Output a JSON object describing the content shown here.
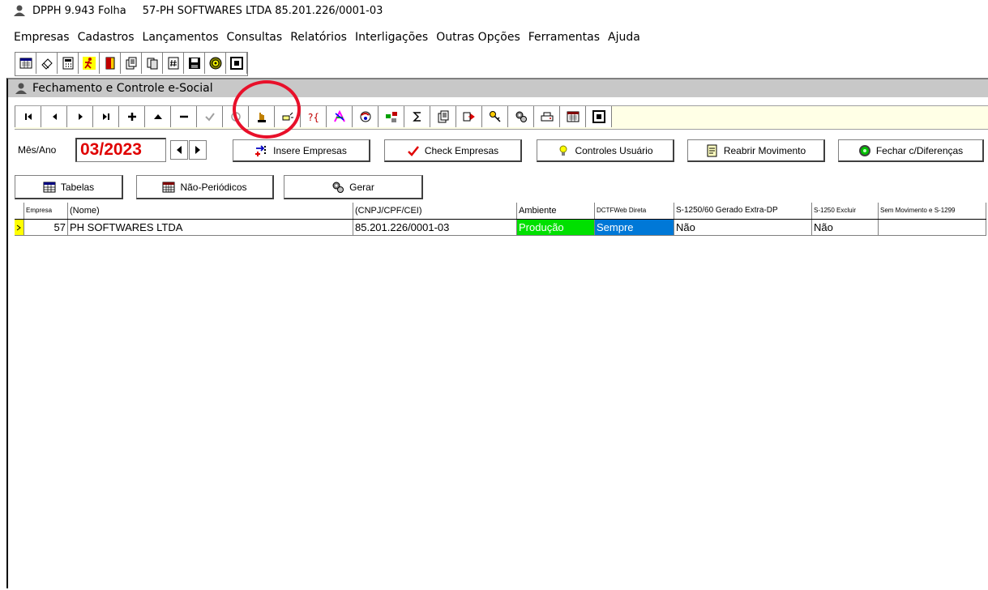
{
  "title": {
    "app": "DPPH 9.943 Folha",
    "company": "57-PH SOFTWARES LTDA  85.201.226/0001-03"
  },
  "menu": [
    "Empresas",
    "Cadastros",
    "Lançamentos",
    "Consultas",
    "Relatórios",
    "Interligações",
    "Outras Opções",
    "Ferramentas",
    "Ajuda"
  ],
  "main_toolbar_icons": [
    "calendar-icon",
    "eraser-icon",
    "calculator-icon",
    "runner-icon",
    "exit-door-icon",
    "report-icon",
    "copy-icon",
    "hash-icon",
    "save-icon",
    "disc-icon",
    "window-icon"
  ],
  "window": {
    "title": "Fechamento e Controle e-Social"
  },
  "nav_toolbar_icons": [
    "first-icon",
    "prior-icon",
    "next-icon",
    "last-icon",
    "insert-icon",
    "edit-icon",
    "delete-icon",
    "post-check-icon",
    "cancel-icon",
    "hand-icon",
    "pointer-icon",
    "query-icon",
    "colors-icon",
    "globe-icon",
    "network-icon",
    "sum-icon",
    "report-icon",
    "export-icon",
    "key-icon",
    "gear-icon",
    "print-icon",
    "calendar-icon",
    "window-icon"
  ],
  "controls": {
    "mes_label": "Mês/Ano",
    "mes_value": "03/2023",
    "insere": "Insere Empresas",
    "check": "Check Empresas",
    "controles": "Controles Usuário",
    "reabrir": "Reabrir Movimento",
    "fechar": "Fechar c/Diferenças",
    "tabelas": "Tabelas",
    "nao_periodicos": "Não-Periódicos",
    "gerar": "Gerar"
  },
  "grid": {
    "headers": [
      "Empresa",
      "(Nome)",
      "(CNPJ/CPF/CEI)",
      "Ambiente",
      "DCTFWeb Direta",
      "S-1250/60 Gerado Extra-DP",
      "S-1250 Excluir",
      "Sem Movimento e S-1299"
    ],
    "row": {
      "empresa": "57",
      "nome": "PH SOFTWARES LTDA",
      "cnpj": "85.201.226/0001-03",
      "ambiente": "Produção",
      "dctf": "Sempre",
      "s1250_60": "Não",
      "s1250_excluir": "Não",
      "sem_mov": ""
    }
  },
  "colors": {
    "ambiente_bg": "#00e000",
    "dctf_bg": "#0078d7",
    "highlight_circle": "#e8102a",
    "mes_value": "#e00000"
  }
}
